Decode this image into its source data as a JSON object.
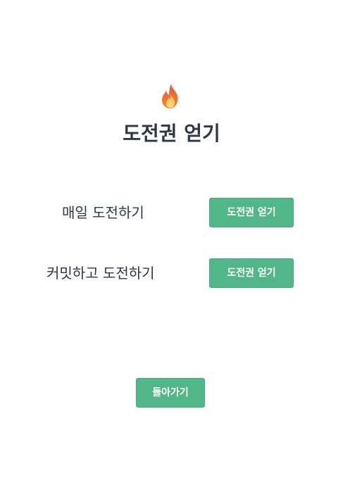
{
  "header": {
    "icon": "fire-icon",
    "title": "도전권 얻기"
  },
  "options": [
    {
      "label": "매일 도전하기",
      "button_label": "도전권 얻기"
    },
    {
      "label": "커밋하고 도전하기",
      "button_label": "도전권 얻기"
    }
  ],
  "footer": {
    "back_label": "돌아가기"
  },
  "colors": {
    "accent": "#52b788",
    "text": "#2d3748",
    "background": "#ffffff"
  }
}
